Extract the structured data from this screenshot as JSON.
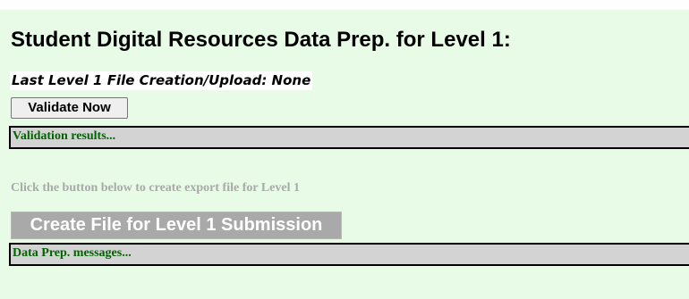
{
  "panel": {
    "title": "Student Digital Resources Data Prep. for Level 1:",
    "last_upload": "Last Level 1 File Creation/Upload: None",
    "validate_button": "Validate Now",
    "validation_results": "Validation results...",
    "export_hint": "Click the button below to create export file for Level 1",
    "create_button": "Create File for Level 1 Submission",
    "create_button_enabled": false,
    "dataprep_messages": "Data Prep. messages..."
  },
  "colors": {
    "panel_background": "#e8fbe7",
    "status_text": "#006400",
    "status_bar": "#d3d3d3",
    "disabled_button": "#a9a9a9"
  }
}
